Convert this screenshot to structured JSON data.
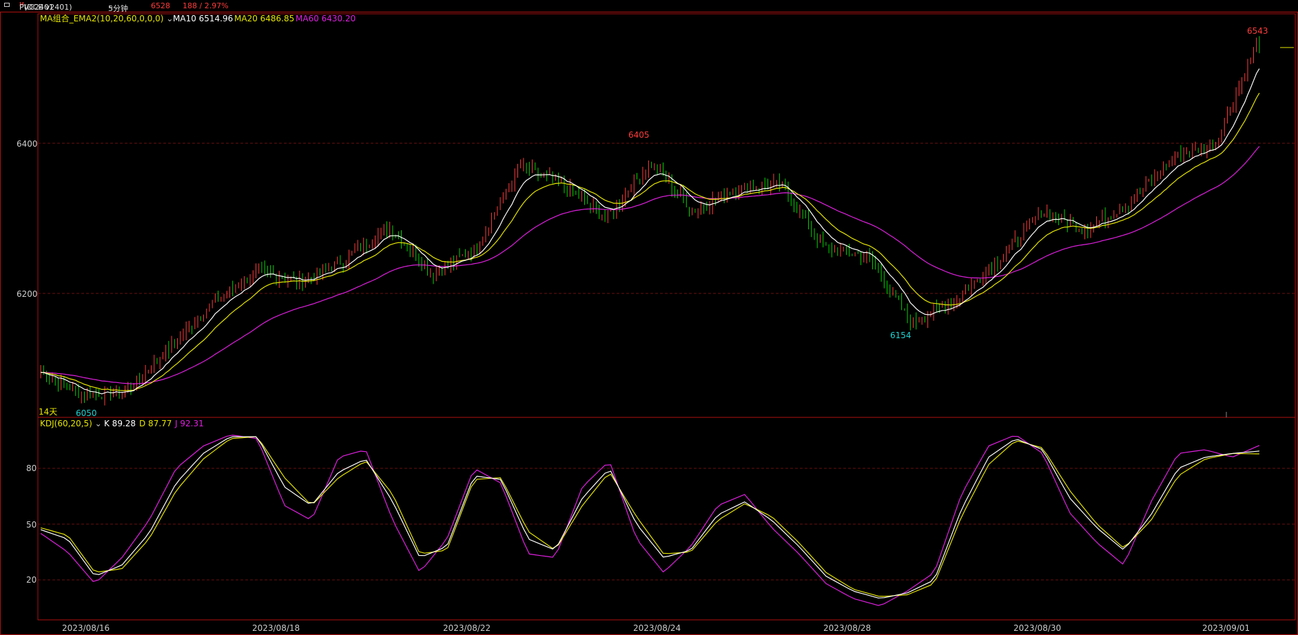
{
  "header": {
    "symbol": "PVC2401",
    "symbol_sup": "M",
    "exchange_note": "(DCE v2401)",
    "period": "5分钟",
    "last_price": "6528",
    "change": "188 / 2.97%"
  },
  "main_indicator": {
    "name": "MA组合_EMA2(10,20,60,0,0,0)",
    "ma10": "MA10 6514.96",
    "ma20": "MA20 6486.85",
    "ma60": "MA60 6430.20"
  },
  "sub_indicator": {
    "name": "KDJ(60,20,5)",
    "k": "K 89.28",
    "d": "D 87.77",
    "j": "J 92.31"
  },
  "labels": {
    "range_days": "14天",
    "high_label": "6405",
    "low_label": "6154",
    "start_low_label": "6050",
    "last_high_label": "6543"
  },
  "colors": {
    "up": "#ff3b3b",
    "down": "#00d400",
    "ma10": "#ffffff",
    "ma20": "#e6e600",
    "ma60": "#e020e0",
    "frame": "#b01010",
    "grid": "#6a0f0f",
    "low_label": "#22d3d3"
  },
  "chart_data": [
    {
      "type": "candlestick",
      "title": "PVC2401 5分钟",
      "y_ticks": [
        "6400",
        "6200"
      ],
      "ylim": [
        6030,
        6560
      ],
      "x_ticks": [
        "2023/08/16",
        "2023/08/18",
        "2023/08/22",
        "2023/08/24",
        "2023/08/28",
        "2023/08/30",
        "2023/09/01"
      ],
      "close_path": {
        "x": [
          "start",
          "2023/08/16",
          "2023/08/17",
          "2023/08/17",
          "2023/08/18",
          "2023/08/18",
          "2023/08/21",
          "2023/08/21",
          "2023/08/22",
          "2023/08/22",
          "2023/08/23",
          "2023/08/23",
          "2023/08/24",
          "2023/08/24",
          "2023/08/25",
          "2023/08/25",
          "2023/08/28",
          "2023/08/28",
          "2023/08/29",
          "2023/08/29",
          "2023/08/30",
          "2023/08/31",
          "2023/08/31",
          "2023/09/01",
          "end"
        ],
        "y": [
          6095,
          6065,
          6070,
          6130,
          6190,
          6230,
          6215,
          6245,
          6290,
          6225,
          6260,
          6370,
          6345,
          6300,
          6375,
          6310,
          6340,
          6345,
          6260,
          6250,
          6160,
          6190,
          6245,
          6310,
          6285,
          6320,
          6380,
          6400,
          6543
        ]
      },
      "annotations": {
        "high": 6405,
        "low": 6154,
        "start_low": 6050,
        "last_high": 6543
      }
    },
    {
      "type": "line",
      "title": "KDJ(60,20,5)",
      "y_ticks": [
        "80",
        "50",
        "20"
      ],
      "ylim": [
        0,
        100
      ],
      "series": [
        {
          "name": "K",
          "values": [
            47,
            42,
            22,
            28,
            45,
            72,
            88,
            97,
            97,
            70,
            60,
            78,
            85,
            62,
            32,
            38,
            76,
            74,
            42,
            36,
            64,
            80,
            50,
            32,
            36,
            55,
            62,
            52,
            38,
            22,
            14,
            10,
            13,
            20,
            58,
            86,
            96,
            90,
            64,
            48,
            36,
            55,
            80,
            86,
            88,
            89.28
          ]
        },
        {
          "name": "D",
          "values": [
            48,
            44,
            24,
            26,
            42,
            68,
            85,
            96,
            97,
            75,
            60,
            75,
            84,
            66,
            34,
            36,
            74,
            75,
            46,
            36,
            60,
            78,
            54,
            34,
            35,
            52,
            61,
            54,
            40,
            24,
            15,
            11,
            12,
            18,
            54,
            82,
            95,
            91,
            68,
            50,
            37,
            52,
            76,
            85,
            88,
            87.77
          ]
        },
        {
          "name": "J",
          "values": [
            45,
            35,
            18,
            32,
            52,
            80,
            92,
            98,
            96,
            60,
            52,
            86,
            90,
            52,
            24,
            42,
            80,
            72,
            34,
            32,
            70,
            84,
            42,
            24,
            38,
            60,
            66,
            48,
            34,
            18,
            10,
            6,
            14,
            24,
            66,
            92,
            98,
            88,
            56,
            40,
            28,
            62,
            88,
            90,
            86,
            92.31
          ]
        }
      ]
    }
  ]
}
